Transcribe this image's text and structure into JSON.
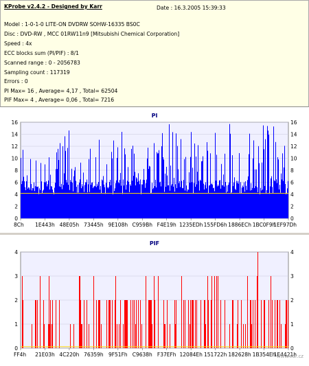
{
  "header": {
    "title": "KProbe v2.4.2 - Designed by Karr",
    "date": "Date : 16.3.2005 15:39:33",
    "lines": [
      "Model : 1-0-1-0 LITE-ON DVDRW SOHW-16335 BS0C",
      "Disc : DVD-RW , MCC 01RW11n9 [Mitsubishi Chemical Corporation]",
      "Speed : 4x",
      "ECC blocks sum (PI/PIF) : 8/1",
      "Scanned range : 0 - 2056783",
      "Sampling count : 117319",
      "Errors : 0",
      "PI Max= 16 , Average= 4,17 , Total= 62504",
      "PIF Max= 4 , Average= 0,06 , Total= 7216"
    ]
  },
  "watermark": "www.cdr.cz",
  "chart_data": [
    {
      "type": "bar",
      "title": "PI",
      "color": "#0000ff",
      "ylim": [
        0,
        16
      ],
      "yticks": [
        "0",
        "2",
        "4",
        "6",
        "8",
        "10",
        "12",
        "14",
        "16"
      ],
      "xticks": [
        "8Ch",
        "1E443h",
        "48E05h",
        "73445h",
        "9E108h",
        "C959Bh",
        "F4E19h",
        "1235EDh",
        "155FD6h",
        "1886ECh",
        "1BC0F9h",
        "1EF97Dh"
      ],
      "max": 16,
      "average": 4.17,
      "grid": true
    },
    {
      "type": "bar",
      "title": "PIF",
      "color": "#ff0000",
      "ylim": [
        0,
        4
      ],
      "yticks": [
        "0",
        "1",
        "2",
        "3",
        "4"
      ],
      "xticks": [
        "FF4h",
        "21E03h",
        "4C220h",
        "76359h",
        "9F51Fh",
        "C9638h",
        "F37EFh",
        "12084Eh",
        "151722h",
        "182628h",
        "1B354Eh",
        "1E4421h"
      ],
      "max": 4,
      "average": 0.06,
      "grid": true
    }
  ]
}
